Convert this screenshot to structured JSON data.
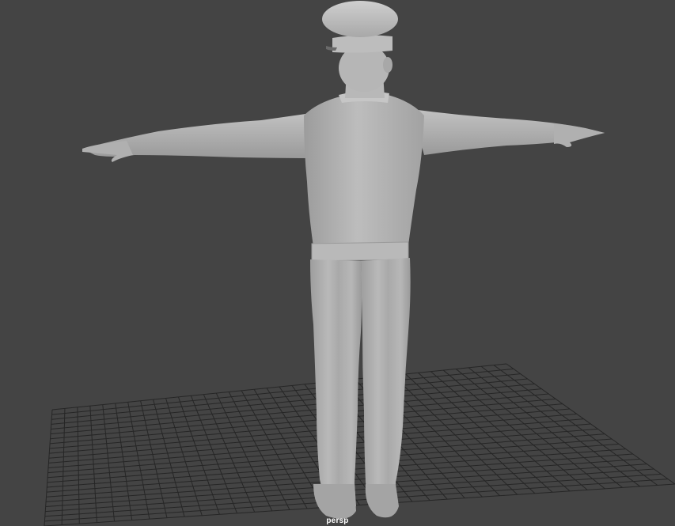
{
  "viewport": {
    "camera_label": "persp",
    "background_color": "#444444",
    "grid_color": "#2a2a2a",
    "model_color": "#b4b4b4",
    "model_name_icon": "t-pose-character-model"
  }
}
